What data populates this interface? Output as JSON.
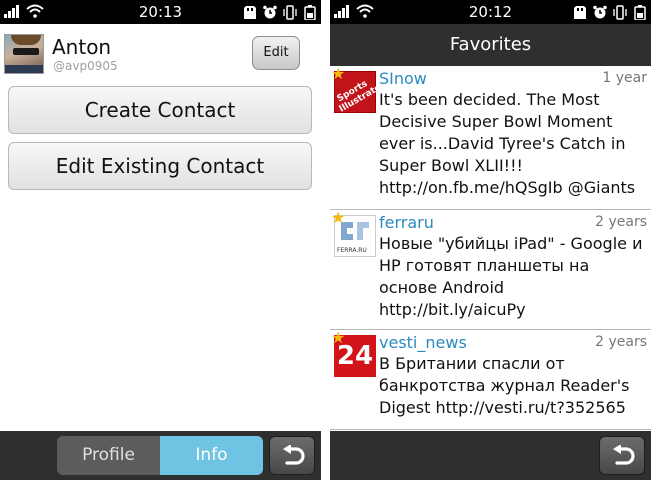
{
  "left_screen": {
    "status_bar": {
      "time": "20:13"
    },
    "profile": {
      "name": "Anton",
      "handle": "@avp0905",
      "edit_label": "Edit"
    },
    "actions": {
      "create_label": "Create Contact",
      "edit_existing_label": "Edit Existing Contact"
    },
    "tabs": [
      {
        "label": "Profile",
        "selected": false
      },
      {
        "label": "Info",
        "selected": true
      }
    ],
    "back_icon": "back-arrow-icon"
  },
  "right_screen": {
    "status_bar": {
      "time": "20:12"
    },
    "title": "Favorites",
    "tweets": [
      {
        "user": "SInow",
        "age": "1 year",
        "text": "It's been decided. The Most Decisive Super Bowl Moment ever is...David Tyree's Catch in Super Bowl XLII!!! http://on.fb.me/hQSgIb @Giants",
        "avatar_text": "Sports Illustrated"
      },
      {
        "user": "ferraru",
        "age": "2 years",
        "text": "Новые \"убийцы iPad\" - Google и  HP готовят планшеты на основе Android http://bit.ly/aicuPy",
        "avatar_text": "FERRA.RU"
      },
      {
        "user": "vesti_news",
        "age": "2 years",
        "text": "В Британии спасли от банкротства журнал Reader's Digest http://vesti.ru/t?352565",
        "avatar_text": "24"
      }
    ],
    "back_icon": "back-arrow-icon"
  },
  "colors": {
    "accent_tab": "#6fc4e4",
    "username": "#2a8bbf",
    "bar": "#2f2f2f",
    "star": "#f2b90f"
  }
}
